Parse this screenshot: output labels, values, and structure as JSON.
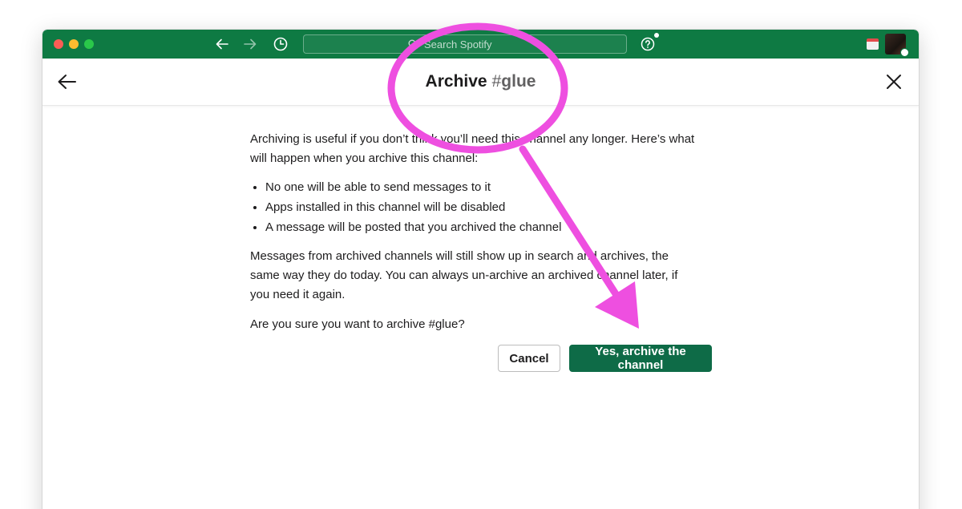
{
  "titlebar": {
    "search_placeholder": "Search Spotify",
    "accent_color": "#0e7a43",
    "icons": [
      "back-arrow-icon",
      "forward-arrow-icon",
      "history-clock-icon",
      "search-icon",
      "help-icon",
      "calendar-icon"
    ]
  },
  "modal": {
    "title": "Archive",
    "hash": "#",
    "channel": "glue",
    "intro": "Archiving is useful if you don’t think you’ll need this channel any longer. Here’s what will happen when you archive this channel:",
    "bullets": [
      "No one will be able to send messages to it",
      "Apps installed in this channel will be disabled",
      "A message will be posted that you archived the channel"
    ],
    "note": "Messages from archived channels will still show up in search and archives, the same way they do today. You can always un-archive an archived channel later, if you need it again.",
    "question": "Are you sure you want to archive #glue?",
    "cancel_label": "Cancel",
    "confirm_label": "Yes, archive the channel",
    "confirm_color": "#0e6b47"
  },
  "annotation": {
    "color": "#ee4fe0",
    "shapes": [
      "highlight-circle",
      "pointer-arrow"
    ]
  }
}
